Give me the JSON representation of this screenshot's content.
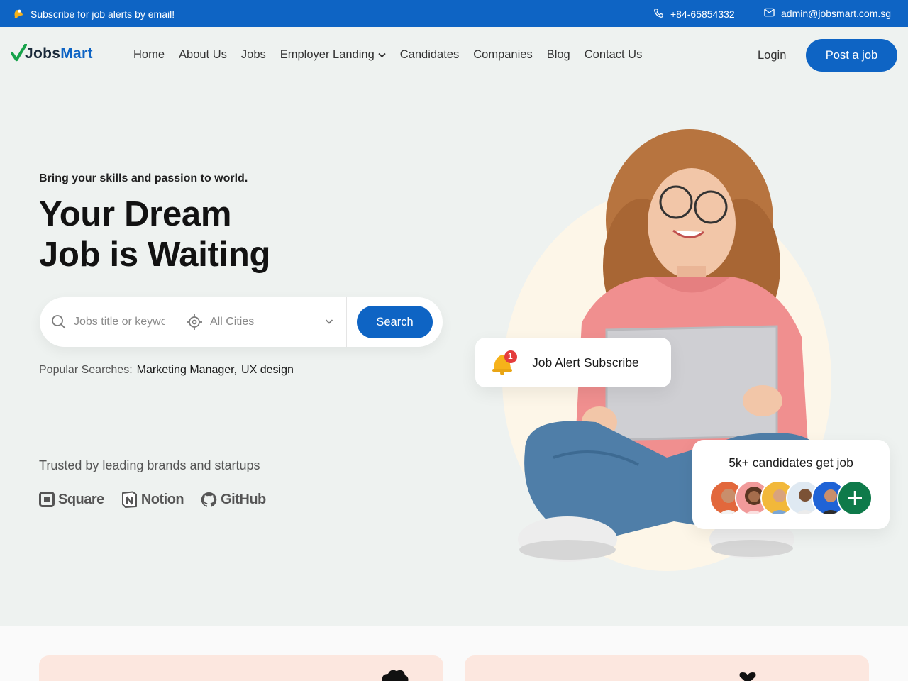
{
  "topbar": {
    "subscribe_text": "Subscribe for job alerts by email!",
    "phone": "+84-65854332",
    "email": "admin@jobsmart.com.sg"
  },
  "brand": {
    "name_part1": "Jobs",
    "name_part2": "Mart"
  },
  "nav": {
    "items": [
      "Home",
      "About Us",
      "Jobs",
      "Employer Landing",
      "Candidates",
      "Companies",
      "Blog",
      "Contact Us"
    ]
  },
  "header": {
    "login_label": "Login",
    "post_job_label": "Post a job"
  },
  "hero": {
    "tagline": "Bring your skills and passion to world.",
    "headline_line1": "Your Dream",
    "headline_line2": "Job is Waiting",
    "search": {
      "keyword_placeholder": "Jobs title or keyword",
      "city_value": "All Cities",
      "button_label": "Search"
    },
    "popular": {
      "label": "Popular Searches:",
      "terms": [
        "Marketing Manager,",
        "UX design"
      ]
    },
    "trusted_text": "Trusted by leading brands and startups",
    "brands": [
      "Square",
      "Notion",
      "GitHub"
    ]
  },
  "cards": {
    "alert_label": "Job Alert Subscribe",
    "alert_badge": "1",
    "candidates_label": "5k+ candidates get job"
  },
  "colors": {
    "primary": "#0e64c4",
    "background": "#eef2f0",
    "accent_green": "#0e7a4a",
    "card_peach": "#fce7df"
  }
}
